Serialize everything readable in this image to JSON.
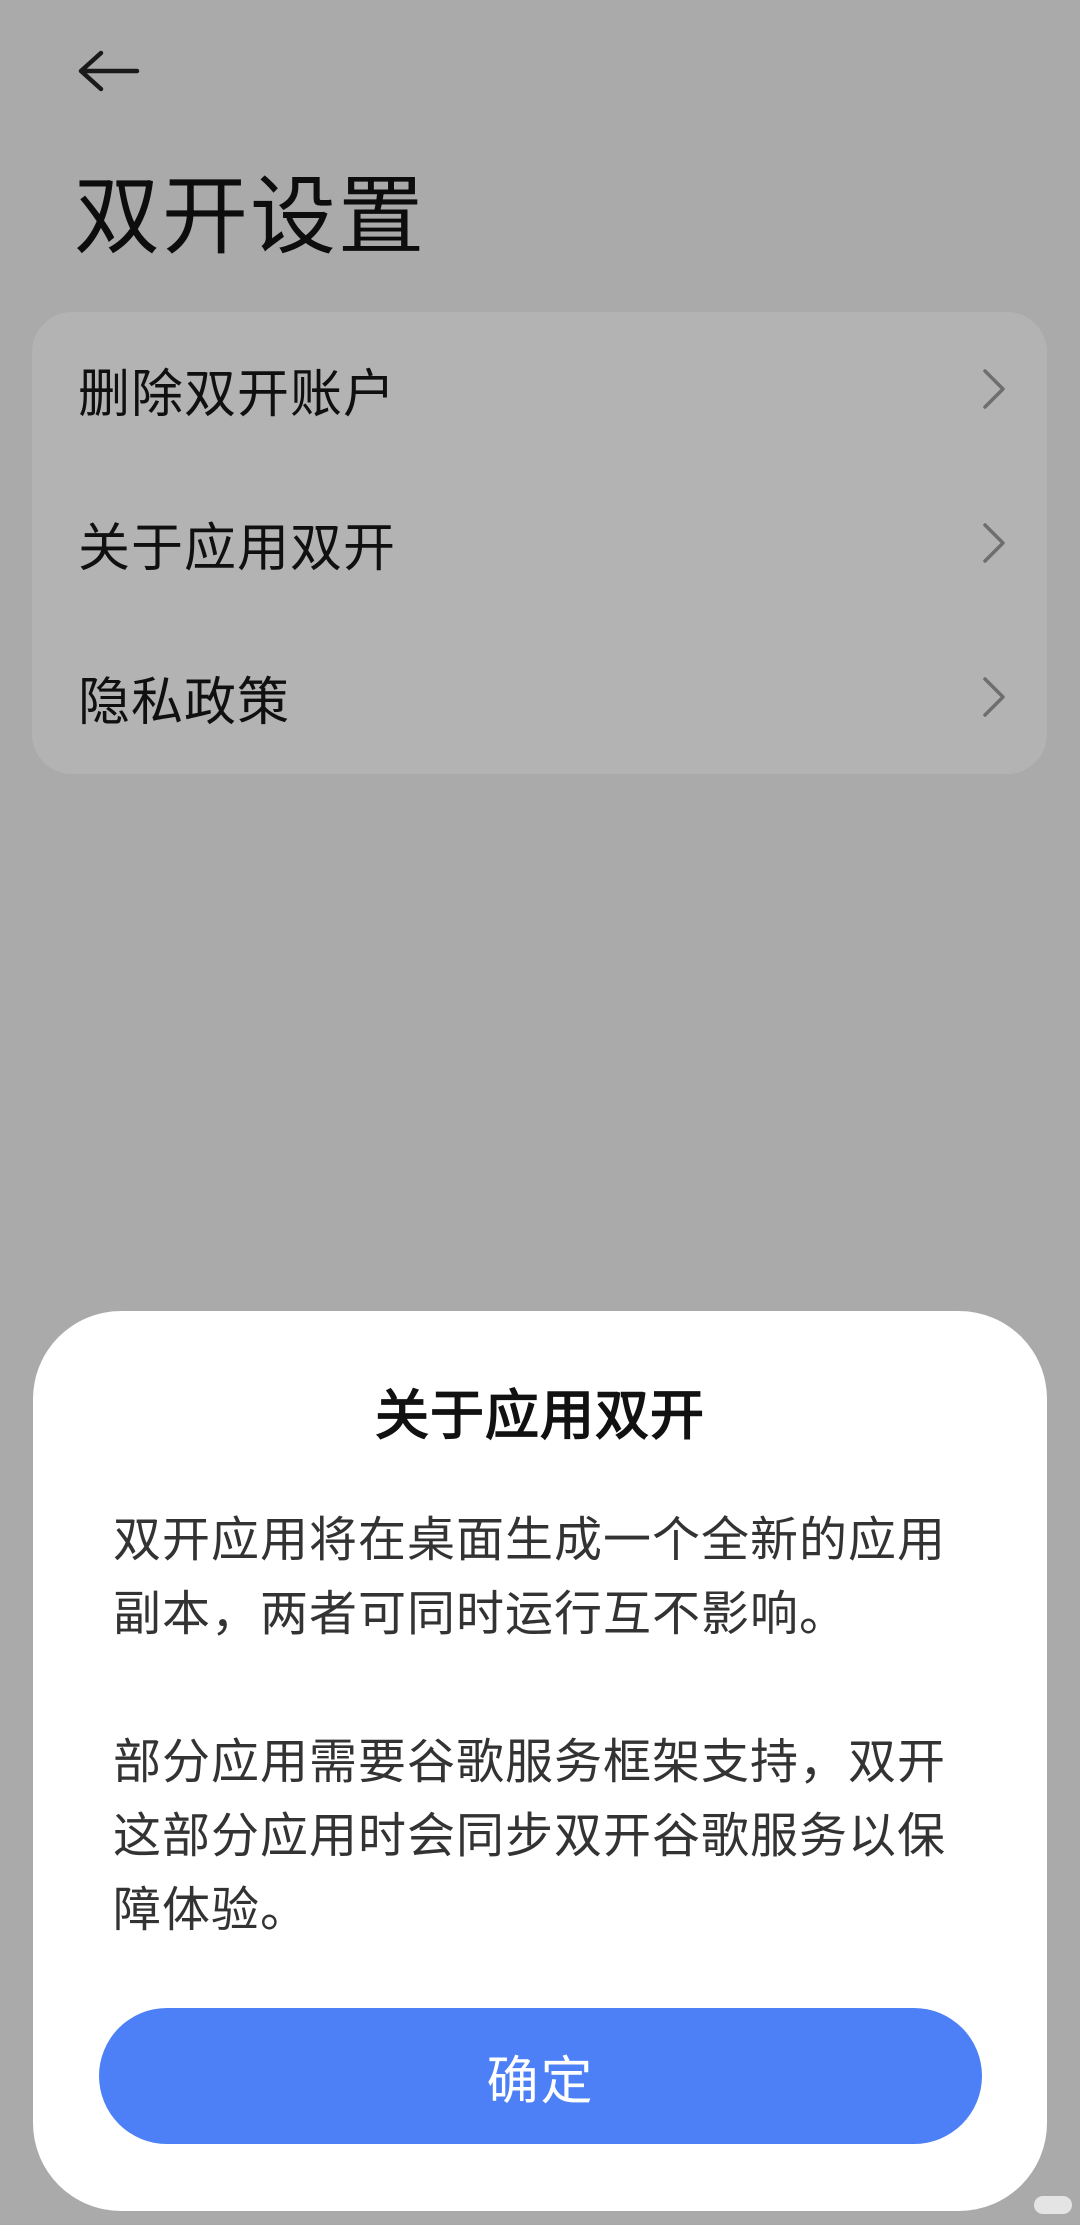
{
  "header": {
    "back_icon": "arrow-left-icon",
    "title": "双开设置"
  },
  "settings": {
    "items": [
      {
        "label": "删除双开账户",
        "icon": "chevron-right-icon"
      },
      {
        "label": "关于应用双开",
        "icon": "chevron-right-icon"
      },
      {
        "label": "隐私政策",
        "icon": "chevron-right-icon"
      }
    ]
  },
  "dialog": {
    "title": "关于应用双开",
    "paragraph_1": "双开应用将在桌面生成一个全新的应用副本，两者可同时运行互不影响。",
    "paragraph_2": "部分应用需要谷歌服务框架支持，双开这部分应用时会同步双开谷歌服务以保障体验。",
    "confirm_label": "确定"
  },
  "colors": {
    "scrim_background": "#aaaaaa",
    "card_background": "#b3b3b3",
    "dialog_background": "#ffffff",
    "primary_button": "#4d80f6"
  }
}
